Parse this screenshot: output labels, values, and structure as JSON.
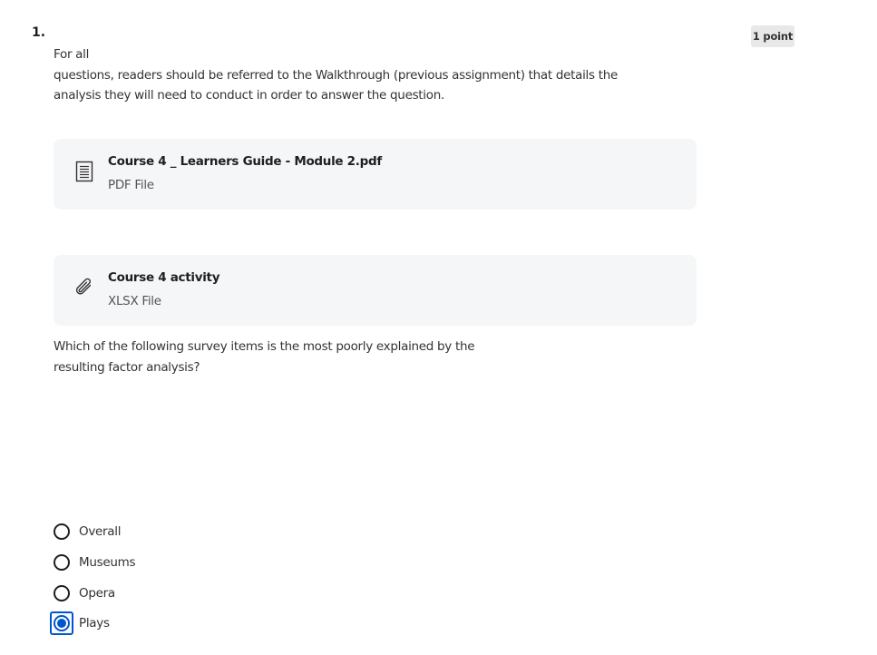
{
  "question": {
    "number": "1.",
    "points": "1 point",
    "prompt_lines": [
      "For all",
      "questions, readers should be referred to the Walkthrough (previous assignment) that details the",
      "analysis they will need to conduct in order to answer the question."
    ],
    "text_lines": [
      "Which of the following survey items is the most poorly explained by the",
      "resulting factor analysis?"
    ]
  },
  "attachments": [
    {
      "title": "Course 4 _ Learners Guide - Module 2.pdf",
      "type": "PDF File",
      "icon": "document-icon"
    },
    {
      "title": "Course 4 activity",
      "type": "XLSX File",
      "icon": "paperclip-icon"
    }
  ],
  "options": [
    {
      "label": "Overall",
      "selected": false
    },
    {
      "label": "Museums",
      "selected": false
    },
    {
      "label": "Opera",
      "selected": false
    },
    {
      "label": "Plays",
      "selected": true
    }
  ],
  "colors": {
    "accent": "#0056d2",
    "card_bg": "#f5f6f7",
    "badge_bg": "#e8e8e8"
  }
}
